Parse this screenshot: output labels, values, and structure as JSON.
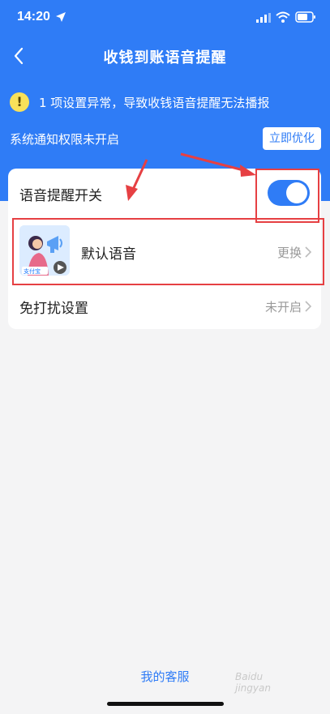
{
  "status_bar": {
    "time": "14:20"
  },
  "nav": {
    "title": "收钱到账语音提醒"
  },
  "warning": {
    "text": "1 项设置异常，导致收钱语音提醒无法播报"
  },
  "notice": {
    "text": "系统通知权限未开启",
    "button": "立即优化"
  },
  "settings": {
    "voice_switch": {
      "label": "语音提醒开关",
      "enabled": true
    },
    "default_voice": {
      "label": "默认语音",
      "action": "更换",
      "thumbnail_text": "支付宝"
    },
    "dnd": {
      "label": "免打扰设置",
      "value": "未开启"
    }
  },
  "footer": {
    "service_link": "我的客服"
  },
  "watermark": {
    "line1": "Baidu",
    "line2": "jingyan"
  },
  "colors": {
    "primary": "#2f7cf6",
    "warning": "#f8e15a",
    "annotation": "#e64043"
  }
}
